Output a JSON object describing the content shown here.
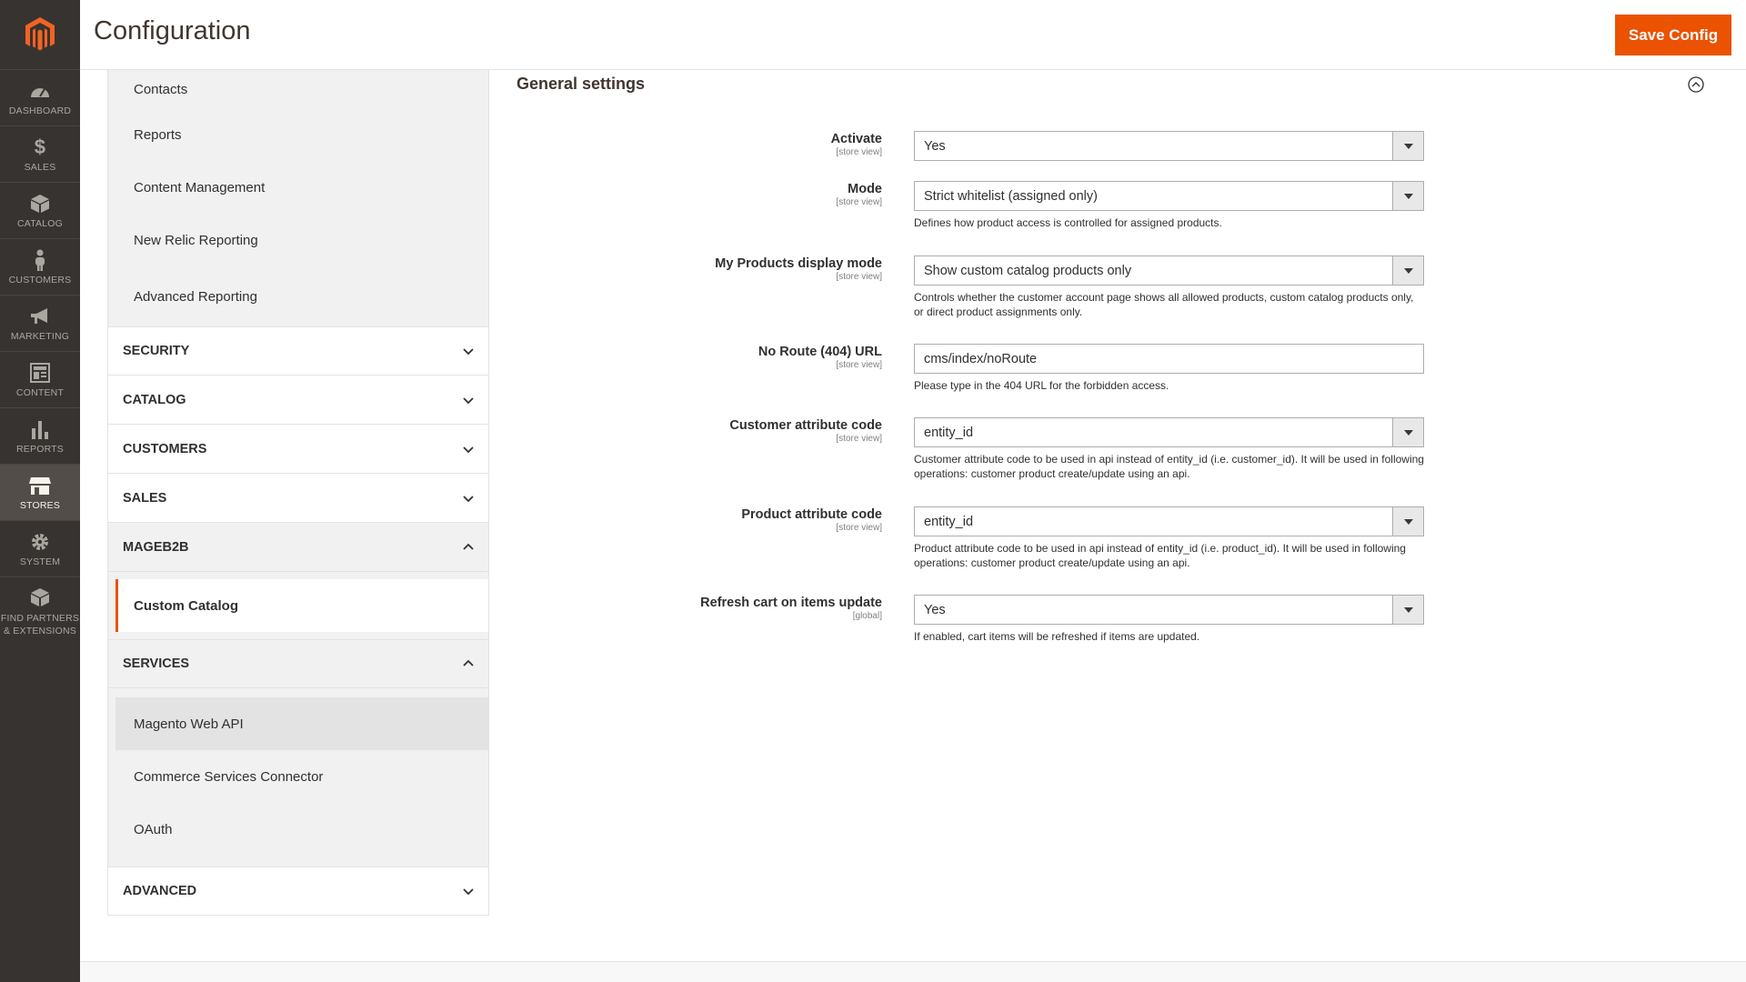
{
  "menu": {
    "items": [
      {
        "key": "dashboard",
        "label": "DASHBOARD"
      },
      {
        "key": "sales",
        "label": "SALES"
      },
      {
        "key": "catalog",
        "label": "CATALOG"
      },
      {
        "key": "customers",
        "label": "CUSTOMERS"
      },
      {
        "key": "marketing",
        "label": "MARKETING"
      },
      {
        "key": "content",
        "label": "CONTENT"
      },
      {
        "key": "reports",
        "label": "REPORTS"
      },
      {
        "key": "stores",
        "label": "STORES"
      },
      {
        "key": "system",
        "label": "SYSTEM"
      }
    ],
    "partners_line1": "FIND PARTNERS",
    "partners_line2": "& EXTENSIONS",
    "active": "stores"
  },
  "header": {
    "title": "Configuration",
    "save_label": "Save Config"
  },
  "nav": {
    "top_items": [
      "Contacts",
      "Reports",
      "Content Management",
      "New Relic Reporting",
      "Advanced Reporting"
    ],
    "sections": {
      "security": "SECURITY",
      "catalog": "CATALOG",
      "customers": "CUSTOMERS",
      "sales": "SALES",
      "mageb2b": "MAGEB2B",
      "services": "SERVICES",
      "advanced": "ADVANCED"
    },
    "mageb2b_items": [
      "Custom Catalog"
    ],
    "services_items": [
      "Magento Web API",
      "Commerce Services Connector",
      "OAuth"
    ]
  },
  "main": {
    "fieldset_title": "General settings",
    "fields": [
      {
        "label": "Activate",
        "scope": "[store view]",
        "value": "Yes",
        "note": ""
      },
      {
        "label": "Mode",
        "scope": "[store view]",
        "value": "Strict whitelist (assigned only)",
        "note": "Defines how product access is controlled for assigned products."
      },
      {
        "label": "My Products display mode",
        "scope": "[store view]",
        "value": "Show custom catalog products only",
        "note": "Controls whether the customer account page shows all allowed products, custom catalog products only, or direct product assignments only."
      },
      {
        "label": "No Route (404) URL",
        "scope": "[store view]",
        "value": "cms/index/noRoute",
        "note": "Please type in the 404 URL for the forbidden access."
      },
      {
        "label": "Customer attribute code",
        "scope": "[store view]",
        "value": "entity_id",
        "note": "Customer attribute code to be used in api instead of entity_id (i.e. customer_id). It will be used in following operations: customer product create/update using an api."
      },
      {
        "label": "Product attribute code",
        "scope": "[store view]",
        "value": "entity_id",
        "note": "Product attribute code to be used in api instead of entity_id (i.e. product_id). It will be used in following operations: customer product create/update using an api."
      },
      {
        "label": "Refresh cart on items update",
        "scope": "[global]",
        "value": "Yes",
        "note": "If enabled, cart items will be refreshed if items are updated."
      }
    ]
  },
  "colors": {
    "accent": "#eb5202",
    "menu_bg": "#373330",
    "menu_active": "#524d49"
  }
}
